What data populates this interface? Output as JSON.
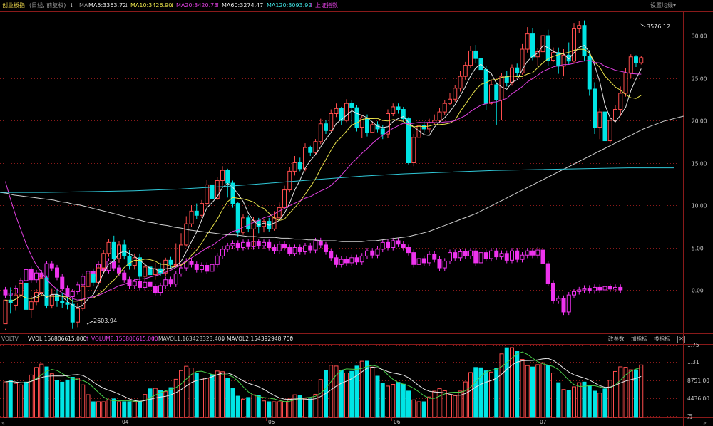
{
  "header": {
    "title": "创业板指",
    "subtitle": "(日线, 前复权)",
    "ma_label": "MA",
    "ma5": "MA5:3363.72",
    "ma10": "MA10:3426.90",
    "ma20": "MA20:3420.73",
    "ma60": "MA60:3274.47",
    "ma120": "MA120:3093.92",
    "ref_index": "上证指数",
    "settings": "设置均线",
    "arrow_down": "↓",
    "arrow_up": "↑",
    "caret": "▾"
  },
  "colors": {
    "up": "#ff4d4d",
    "down": "#00e5e5",
    "ma5": "#e6e6e6",
    "ma10": "#e8e14a",
    "ma20": "#e040e0",
    "ma60": "#cfcfcf",
    "ma120": "#30c8d8",
    "ref": "#ee33ee",
    "grid": "#8a1a1a"
  },
  "annotations": {
    "high": "3576.12",
    "low": "2603.94"
  },
  "main_axis": [
    "30.00",
    "25.00",
    "20.00",
    "15.00",
    "10.00",
    "5.00",
    "0.00"
  ],
  "volume_bar": {
    "label": "VOLTV",
    "vvol": "VVOL:156806615.000",
    "volume": "VOLUME:156806615.000",
    "mavol1": "MAVOL1:163428323.400",
    "mavol2": "MAVOL2:154392948.700",
    "edit_params": "改参数",
    "add_indicator": "加指标",
    "swap_indicator": "换指标",
    "close": "✕"
  },
  "volume_axis": [
    "1.75",
    "1.31",
    "8751.00",
    "4436.00",
    "万"
  ],
  "date_axis": [
    "04",
    "05",
    "06",
    "07"
  ],
  "chart_data": {
    "type": "candlestick",
    "unit": "percent",
    "ylim": [
      -4,
      33
    ],
    "index_candles": [
      [
        -4,
        -1.2,
        -4.6,
        -4.7
      ],
      [
        -1.2,
        -1.5,
        0.3,
        -2.8
      ],
      [
        -1.8,
        -0.6,
        0.2,
        -2.4
      ],
      [
        -0.6,
        0.8,
        1.4,
        -0.9
      ],
      [
        0.8,
        -2.3,
        1.2,
        -2.7
      ],
      [
        -2.3,
        -1.4,
        -0.7,
        -3.3
      ],
      [
        -1.4,
        -0.3,
        0.1,
        -1.8
      ],
      [
        -0.3,
        1.4,
        1.8,
        -0.6
      ],
      [
        1.4,
        -1.8,
        1.7,
        -2.2
      ],
      [
        -1.8,
        -0.6,
        0.2,
        -2.2
      ],
      [
        -0.6,
        -1.3,
        0.2,
        -2.0
      ],
      [
        -1.3,
        -1.5,
        -0.3,
        -2.1
      ],
      [
        -1.5,
        -1.7,
        -0.8,
        -2.3
      ],
      [
        -1.7,
        -3.8,
        -1.1,
        -4.6
      ],
      [
        -3.8,
        -2.2,
        -1.6,
        -4.4
      ],
      [
        -2.2,
        0.4,
        0.8,
        -2.5
      ],
      [
        0.4,
        1.9,
        2.3,
        0.0
      ],
      [
        1.9,
        0.9,
        2.4,
        0.5
      ],
      [
        0.9,
        2.6,
        3.1,
        0.5
      ],
      [
        2.6,
        4.3,
        4.7,
        2.0
      ],
      [
        4.3,
        5.6,
        6.0,
        3.9
      ],
      [
        5.6,
        3.7,
        6.4,
        3.3
      ],
      [
        3.7,
        5.3,
        5.8,
        3.2
      ],
      [
        5.3,
        4.0,
        5.9,
        3.6
      ],
      [
        4.0,
        2.9,
        4.7,
        2.4
      ],
      [
        2.9,
        3.8,
        4.3,
        2.4
      ],
      [
        3.8,
        1.6,
        4.3,
        1.2
      ],
      [
        1.6,
        2.7,
        3.2,
        1.2
      ],
      [
        2.7,
        1.8,
        3.2,
        1.4
      ],
      [
        1.8,
        2.5,
        3.2,
        1.2
      ],
      [
        2.5,
        2.0,
        3.2,
        1.6
      ],
      [
        2.0,
        3.5,
        3.8,
        1.6
      ],
      [
        3.5,
        3.0,
        3.9,
        2.6
      ],
      [
        3.0,
        3.0,
        5.5,
        2.8
      ],
      [
        3.0,
        5.3,
        6.7,
        2.8
      ],
      [
        5.3,
        7.8,
        8.7,
        5.1
      ],
      [
        7.8,
        9.3,
        10.0,
        7.4
      ],
      [
        9.3,
        8.8,
        10.2,
        8.4
      ],
      [
        8.8,
        10.2,
        10.6,
        8.5
      ],
      [
        10.2,
        12.4,
        13.0,
        9.9
      ],
      [
        12.4,
        10.8,
        12.8,
        10.4
      ],
      [
        10.8,
        12.9,
        13.3,
        10.6
      ],
      [
        12.9,
        14.1,
        14.6,
        12.3
      ],
      [
        14.1,
        12.6,
        14.3,
        10.9
      ],
      [
        12.6,
        10.2,
        12.9,
        9.7
      ],
      [
        10.2,
        6.8,
        10.4,
        6.3
      ],
      [
        6.8,
        8.5,
        8.9,
        6.5
      ],
      [
        8.5,
        7.2,
        8.8,
        6.8
      ],
      [
        7.2,
        8.2,
        8.6,
        5.2
      ],
      [
        8.2,
        7.5,
        8.5,
        6.7
      ],
      [
        7.5,
        8.1,
        8.4,
        6.8
      ],
      [
        8.1,
        7.2,
        8.5,
        6.9
      ],
      [
        7.2,
        8.5,
        9.3,
        7.0
      ],
      [
        8.5,
        9.7,
        10.3,
        8.2
      ],
      [
        9.7,
        11.8,
        12.3,
        9.5
      ],
      [
        11.8,
        14.0,
        14.5,
        11.5
      ],
      [
        14.0,
        15.0,
        15.8,
        13.5
      ],
      [
        15.0,
        14.3,
        15.6,
        14.0
      ],
      [
        14.3,
        16.8,
        17.3,
        14.0
      ],
      [
        16.8,
        16.2,
        17.0,
        15.8
      ],
      [
        16.2,
        17.5,
        17.8,
        16.0
      ],
      [
        17.5,
        19.6,
        20.2,
        17.2
      ],
      [
        19.6,
        18.8,
        20.0,
        18.4
      ],
      [
        18.8,
        20.8,
        21.3,
        18.7
      ],
      [
        20.8,
        21.4,
        22.0,
        20.4
      ],
      [
        21.4,
        20.0,
        21.6,
        19.5
      ],
      [
        20.0,
        22.0,
        22.5,
        19.8
      ],
      [
        22.0,
        21.5,
        22.4,
        19.4
      ],
      [
        21.5,
        19.2,
        21.8,
        18.7
      ],
      [
        19.2,
        20.3,
        20.6,
        17.9
      ],
      [
        20.3,
        18.6,
        20.7,
        18.1
      ],
      [
        18.6,
        19.5,
        19.9,
        18.6
      ],
      [
        19.5,
        19.0,
        19.9,
        18.6
      ],
      [
        19.0,
        18.4,
        19.5,
        17.8
      ],
      [
        18.4,
        20.8,
        21.3,
        17.9
      ],
      [
        20.8,
        21.6,
        22.0,
        20.5
      ],
      [
        21.6,
        21.3,
        22.0,
        20.8
      ],
      [
        21.3,
        20.2,
        21.6,
        19.8
      ],
      [
        20.2,
        15.0,
        20.4,
        14.8
      ],
      [
        15.0,
        18.0,
        18.4,
        14.6
      ],
      [
        18.0,
        19.4,
        19.6,
        17.6
      ],
      [
        19.4,
        19.0,
        19.9,
        18.6
      ],
      [
        19.0,
        19.7,
        20.2,
        18.6
      ],
      [
        19.7,
        20.0,
        20.7,
        19.5
      ],
      [
        20.0,
        21.0,
        21.5,
        19.8
      ],
      [
        21.0,
        22.0,
        22.4,
        20.6
      ],
      [
        22.0,
        22.5,
        23.2,
        21.8
      ],
      [
        22.5,
        23.8,
        24.2,
        22.2
      ],
      [
        23.8,
        25.2,
        25.8,
        23.4
      ],
      [
        25.2,
        26.5,
        26.9,
        24.8
      ],
      [
        26.5,
        28.2,
        28.8,
        26.2
      ],
      [
        28.2,
        27.3,
        28.9,
        26.8
      ],
      [
        27.3,
        26.0,
        27.8,
        25.6
      ],
      [
        26.0,
        22.0,
        26.4,
        21.2
      ],
      [
        22.0,
        24.2,
        24.8,
        21.8
      ],
      [
        24.2,
        22.4,
        24.5,
        19.5
      ],
      [
        22.4,
        25.2,
        25.6,
        20.0
      ],
      [
        25.2,
        24.5,
        25.8,
        24.0
      ],
      [
        24.5,
        26.2,
        26.6,
        24.1
      ],
      [
        26.2,
        25.6,
        26.7,
        25.2
      ],
      [
        25.6,
        28.4,
        29.0,
        25.4
      ],
      [
        28.4,
        30.2,
        31.0,
        28.0
      ],
      [
        30.2,
        27.5,
        30.9,
        27.1
      ],
      [
        27.5,
        28.1,
        28.5,
        26.4
      ],
      [
        28.1,
        30.0,
        30.8,
        27.8
      ],
      [
        30.0,
        27.1,
        30.7,
        26.4
      ],
      [
        27.1,
        28.0,
        28.6,
        26.9
      ],
      [
        28.0,
        26.4,
        28.6,
        25.5
      ],
      [
        26.4,
        27.7,
        28.4,
        25.2
      ],
      [
        27.7,
        27.0,
        29.2,
        26.6
      ],
      [
        27.0,
        30.8,
        31.5,
        26.8
      ],
      [
        30.8,
        31.2,
        31.7,
        30.3
      ],
      [
        31.2,
        27.6,
        31.8,
        27.0
      ],
      [
        27.6,
        23.7,
        28.3,
        22.9
      ],
      [
        23.7,
        19.2,
        24.5,
        18.4
      ],
      [
        19.2,
        21.0,
        21.4,
        17.8
      ],
      [
        21.0,
        17.6,
        21.5,
        16.2
      ],
      [
        17.6,
        20.0,
        20.4,
        17.3
      ],
      [
        20.0,
        21.3,
        21.8,
        19.8
      ],
      [
        21.3,
        23.2,
        24.0,
        20.5
      ],
      [
        23.2,
        25.6,
        26.2,
        22.8
      ],
      [
        25.6,
        27.5,
        27.8,
        25.0
      ],
      [
        27.5,
        26.8,
        27.7,
        26.3
      ],
      [
        26.8,
        27.4,
        27.6,
        26.6
      ]
    ],
    "ref_bars": [
      [
        0.0,
        -0.6
      ],
      [
        -0.6,
        -0.4
      ],
      [
        -0.4,
        0.2
      ],
      [
        0.2,
        1.1
      ],
      [
        1.1,
        2.4
      ],
      [
        2.4,
        1.2
      ],
      [
        1.2,
        2.0
      ],
      [
        2.0,
        1.5
      ],
      [
        1.5,
        3.1
      ],
      [
        3.1,
        2.6
      ],
      [
        2.6,
        1.5
      ],
      [
        1.5,
        0.2
      ],
      [
        0.2,
        -0.8
      ],
      [
        -0.8,
        -0.2
      ],
      [
        -0.2,
        0.6
      ],
      [
        0.6,
        1.6
      ],
      [
        1.6,
        2.2
      ],
      [
        2.2,
        1.6
      ],
      [
        1.6,
        3.0
      ],
      [
        3.0,
        2.3
      ],
      [
        2.3,
        3.4
      ],
      [
        3.4,
        2.6
      ],
      [
        2.6,
        2.0
      ],
      [
        2.0,
        1.2
      ],
      [
        1.2,
        0.5
      ],
      [
        0.5,
        1.0
      ],
      [
        1.0,
        0.3
      ],
      [
        0.3,
        0.9
      ],
      [
        0.9,
        0.4
      ],
      [
        0.4,
        -0.3
      ],
      [
        -0.3,
        0.5
      ],
      [
        0.5,
        1.2
      ],
      [
        1.2,
        0.7
      ],
      [
        0.7,
        1.9
      ],
      [
        1.9,
        2.6
      ],
      [
        2.6,
        3.4
      ],
      [
        3.4,
        3.0
      ],
      [
        3.0,
        2.4
      ],
      [
        2.4,
        2.9
      ],
      [
        2.9,
        2.2
      ],
      [
        2.2,
        3.0
      ],
      [
        3.0,
        4.0
      ],
      [
        4.0,
        4.8
      ],
      [
        4.8,
        5.2
      ],
      [
        5.2,
        5.5
      ],
      [
        5.5,
        5.0
      ],
      [
        5.0,
        5.6
      ],
      [
        5.6,
        5.1
      ],
      [
        5.1,
        5.7
      ],
      [
        5.7,
        5.2
      ],
      [
        5.2,
        5.6
      ],
      [
        5.6,
        5.0
      ],
      [
        5.0,
        4.6
      ],
      [
        4.6,
        5.4
      ],
      [
        5.4,
        5.0
      ],
      [
        5.0,
        4.3
      ],
      [
        4.3,
        5.0
      ],
      [
        5.0,
        4.5
      ],
      [
        4.5,
        5.2
      ],
      [
        5.2,
        4.7
      ],
      [
        4.7,
        5.8
      ],
      [
        5.8,
        5.3
      ],
      [
        5.3,
        4.5
      ],
      [
        4.5,
        3.8
      ],
      [
        3.8,
        3.0
      ],
      [
        3.0,
        3.6
      ],
      [
        3.6,
        3.2
      ],
      [
        3.2,
        3.8
      ],
      [
        3.8,
        3.3
      ],
      [
        3.3,
        4.0
      ],
      [
        4.0,
        4.6
      ],
      [
        4.6,
        4.1
      ],
      [
        4.1,
        4.8
      ],
      [
        4.8,
        5.6
      ],
      [
        5.6,
        5.0
      ],
      [
        5.0,
        5.8
      ],
      [
        5.8,
        5.4
      ],
      [
        5.4,
        5.0
      ],
      [
        5.0,
        4.4
      ],
      [
        4.4,
        3.0
      ],
      [
        3.0,
        3.7
      ],
      [
        3.7,
        3.2
      ],
      [
        3.2,
        4.2
      ],
      [
        4.2,
        3.6
      ],
      [
        3.6,
        2.6
      ],
      [
        2.6,
        3.4
      ],
      [
        3.4,
        4.4
      ],
      [
        4.4,
        3.8
      ],
      [
        3.8,
        4.5
      ],
      [
        4.5,
        4.0
      ],
      [
        4.0,
        4.6
      ],
      [
        4.6,
        3.2
      ],
      [
        3.2,
        4.4
      ],
      [
        4.4,
        3.7
      ],
      [
        3.7,
        4.6
      ],
      [
        4.6,
        3.9
      ],
      [
        3.9,
        4.3
      ],
      [
        4.3,
        3.5
      ],
      [
        3.5,
        4.6
      ],
      [
        4.6,
        3.6
      ],
      [
        3.6,
        4.1
      ],
      [
        4.1,
        4.6
      ],
      [
        4.6,
        4.1
      ],
      [
        4.1,
        4.7
      ],
      [
        4.7,
        3.1
      ],
      [
        3.1,
        0.8
      ],
      [
        0.8,
        -1.3
      ],
      [
        -1.3,
        -1.0
      ],
      [
        -1.0,
        -2.6
      ],
      [
        -2.6,
        -0.6
      ],
      [
        -0.6,
        -0.2
      ],
      [
        -0.2,
        0.0
      ],
      [
        0.0,
        0.2
      ],
      [
        0.2,
        -0.1
      ],
      [
        -0.1,
        0.3
      ],
      [
        0.3,
        0.0
      ],
      [
        0.0,
        0.4
      ],
      [
        0.4,
        0.1
      ],
      [
        0.1,
        0.3
      ],
      [
        0.3,
        0.0
      ]
    ],
    "ma60_series": [
      11.5,
      11.4,
      11.2,
      11.1,
      11.0,
      10.9,
      10.8,
      10.7,
      10.6,
      10.4,
      10.3,
      10.1,
      10.0,
      9.8,
      9.6,
      9.4,
      9.2,
      9.0,
      8.8,
      8.6,
      8.4,
      8.2,
      8.0,
      7.9,
      7.7,
      7.6,
      7.4,
      7.3,
      7.1,
      7.0,
      6.9,
      6.8,
      6.7,
      6.6,
      6.5,
      6.5,
      6.4,
      6.3,
      6.3,
      6.2,
      6.2,
      6.2,
      6.1,
      6.1,
      6.0,
      6.0,
      5.9,
      5.9,
      5.8,
      5.8,
      5.8,
      5.7,
      5.7,
      5.7,
      5.7,
      5.8,
      5.8,
      5.9,
      6.0,
      6.1,
      6.2,
      6.3,
      6.5,
      6.7,
      6.9,
      7.2,
      7.5,
      7.8,
      8.1,
      8.4,
      8.7,
      9.0,
      9.4,
      9.8,
      10.2,
      10.6,
      11.0,
      11.4,
      11.8,
      12.2,
      12.6,
      13.0,
      13.4,
      13.8,
      14.2,
      14.6,
      15.0,
      15.4,
      15.8,
      16.2,
      16.6,
      17.0,
      17.4,
      17.8,
      18.2,
      18.6,
      19.0,
      19.3,
      19.6,
      19.9,
      20.1,
      20.3,
      20.5
    ],
    "ma120_series": [
      11.5,
      11.5,
      11.6,
      11.7,
      11.9,
      12.2,
      12.6,
      13.0,
      13.4,
      13.7,
      13.9,
      14.1,
      14.2,
      14.3,
      14.4,
      14.4
    ]
  }
}
